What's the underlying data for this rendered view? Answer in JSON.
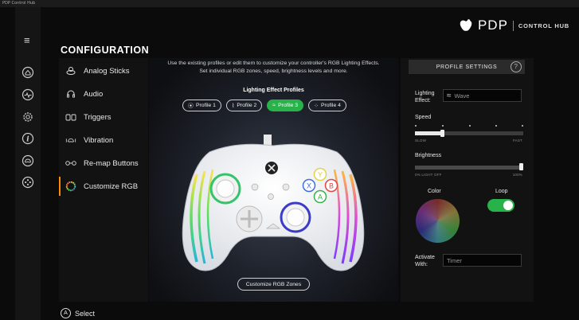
{
  "window": {
    "title": "PDP Control Hub"
  },
  "brand": {
    "logo": "PDP",
    "hub": "CONTROL HUB"
  },
  "page": {
    "title": "CONFIGURATION"
  },
  "sidebar_icons": [
    "menu-icon",
    "home-icon",
    "pulse-icon",
    "gear-icon",
    "info-icon",
    "controller-icon",
    "dpad-icon"
  ],
  "menu": {
    "items": [
      {
        "label": "Analog Sticks",
        "icon": "analog-stick-icon"
      },
      {
        "label": "Audio",
        "icon": "headset-icon"
      },
      {
        "label": "Triggers",
        "icon": "triggers-icon"
      },
      {
        "label": "Vibration",
        "icon": "vibration-icon"
      },
      {
        "label": "Re-map Buttons",
        "icon": "remap-icon"
      },
      {
        "label": "Customize RGB",
        "icon": "rgb-ring-icon",
        "active": true
      }
    ]
  },
  "center": {
    "description_line1": "Use the existing profiles or edit them to customize your controller's RGB Lighting Effects.",
    "description_line2": "Set individual RGB zones, speed, brightness levels and more.",
    "profiles_title": "Lighting Effect Profiles",
    "profiles": [
      {
        "label": "Profile 1",
        "icon": "⦿"
      },
      {
        "label": "Profile 2",
        "icon": "⌇"
      },
      {
        "label": "Profile 3",
        "icon": "≈",
        "selected": true
      },
      {
        "label": "Profile 4",
        "icon": "⁘"
      }
    ],
    "zones_button": "Customize RGB Zones"
  },
  "settings": {
    "header": "PROFILE SETTINGS",
    "help": "?",
    "lighting_label_1": "Lighting",
    "lighting_label_2": "Effect:",
    "lighting_value": "Wave",
    "lighting_icon": "≈",
    "speed_label": "Speed",
    "speed_min": "SLOW",
    "speed_max": "FAST",
    "speed_level": 0.25,
    "brightness_label": "Brightness",
    "brightness_min": "0% LIGHT OFF",
    "brightness_max": "100%",
    "brightness_level": 1.0,
    "color_label": "Color",
    "loop_label": "Loop",
    "loop_on": true,
    "activate_label_1": "Activate",
    "activate_label_2": "With:",
    "activate_placeholder": "Timer"
  },
  "footer": {
    "button": "A",
    "label": "Select"
  },
  "colors": {
    "accent": "#28b24a",
    "active_marker": "#ff8a00"
  }
}
